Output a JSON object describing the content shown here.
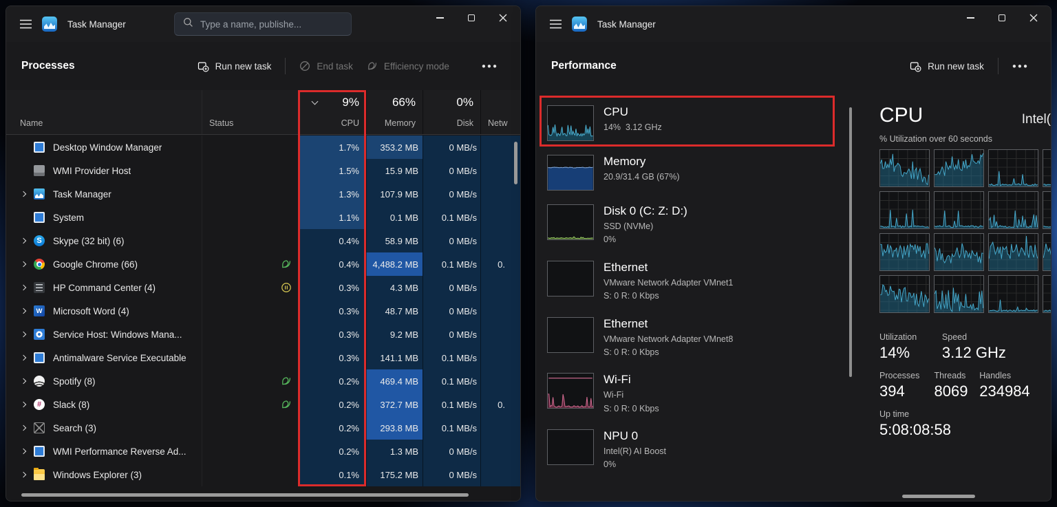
{
  "left_window": {
    "app_title": "Task Manager",
    "search": {
      "placeholder": "Type a name, publishe..."
    },
    "toolbar": {
      "heading": "Processes",
      "run_new_task": "Run new task",
      "end_task": "End task",
      "efficiency_mode": "Efficiency mode",
      "more": "●●●"
    },
    "table": {
      "headers": {
        "name": "Name",
        "status": "Status",
        "cpu": "CPU",
        "memory": "Memory",
        "disk": "Disk",
        "network": "Netw"
      },
      "totals": {
        "cpu": "9%",
        "memory": "66%",
        "disk": "0%"
      },
      "rows": [
        {
          "name": "Desktop Window Manager",
          "icon": "window",
          "expand": false,
          "status": "",
          "cpu": "1.7%",
          "cpu_heat": 2,
          "memory": "353.2 MB",
          "mem_heat": 2,
          "disk": "0 MB/s",
          "network": ""
        },
        {
          "name": "WMI Provider Host",
          "icon": "wmi",
          "expand": false,
          "status": "",
          "cpu": "1.5%",
          "cpu_heat": 2,
          "memory": "15.9 MB",
          "mem_heat": 0,
          "disk": "0 MB/s",
          "network": ""
        },
        {
          "name": "Task Manager",
          "icon": "taskmgr",
          "expand": true,
          "status": "",
          "cpu": "1.3%",
          "cpu_heat": 2,
          "memory": "107.9 MB",
          "mem_heat": 0,
          "disk": "0 MB/s",
          "network": ""
        },
        {
          "name": "System",
          "icon": "window",
          "expand": false,
          "status": "",
          "cpu": "1.1%",
          "cpu_heat": 2,
          "memory": "0.1 MB",
          "mem_heat": 0,
          "disk": "0.1 MB/s",
          "network": ""
        },
        {
          "name": "Skype (32 bit) (6)",
          "icon": "skype",
          "expand": true,
          "status": "",
          "cpu": "0.4%",
          "cpu_heat": 0,
          "memory": "58.9 MB",
          "mem_heat": 0,
          "disk": "0 MB/s",
          "network": ""
        },
        {
          "name": "Google Chrome (66)",
          "icon": "chrome",
          "expand": true,
          "status": "leaf",
          "cpu": "0.4%",
          "cpu_heat": 0,
          "memory": "4,488.2 MB",
          "mem_heat": 3,
          "disk": "0.1 MB/s",
          "network": "0."
        },
        {
          "name": "HP Command Center (4)",
          "icon": "hp",
          "expand": true,
          "status": "pause",
          "cpu": "0.3%",
          "cpu_heat": 0,
          "memory": "4.3 MB",
          "mem_heat": 0,
          "disk": "0 MB/s",
          "network": ""
        },
        {
          "name": "Microsoft Word (4)",
          "icon": "word",
          "expand": true,
          "status": "",
          "cpu": "0.3%",
          "cpu_heat": 0,
          "memory": "48.7 MB",
          "mem_heat": 0,
          "disk": "0 MB/s",
          "network": ""
        },
        {
          "name": "Service Host: Windows Mana...",
          "icon": "gear",
          "expand": true,
          "status": "",
          "cpu": "0.3%",
          "cpu_heat": 0,
          "memory": "9.2 MB",
          "mem_heat": 0,
          "disk": "0 MB/s",
          "network": ""
        },
        {
          "name": "Antimalware Service Executable",
          "icon": "window",
          "expand": true,
          "status": "",
          "cpu": "0.3%",
          "cpu_heat": 0,
          "memory": "141.1 MB",
          "mem_heat": 0,
          "disk": "0.1 MB/s",
          "network": ""
        },
        {
          "name": "Spotify (8)",
          "icon": "spotify",
          "expand": true,
          "status": "leaf",
          "cpu": "0.2%",
          "cpu_heat": 0,
          "memory": "469.4 MB",
          "mem_heat": 3,
          "disk": "0.1 MB/s",
          "network": ""
        },
        {
          "name": "Slack (8)",
          "icon": "slack",
          "expand": true,
          "status": "leaf",
          "cpu": "0.2%",
          "cpu_heat": 0,
          "memory": "372.7 MB",
          "mem_heat": 3,
          "disk": "0.1 MB/s",
          "network": "0."
        },
        {
          "name": "Search (3)",
          "icon": "search",
          "expand": true,
          "status": "",
          "cpu": "0.2%",
          "cpu_heat": 0,
          "memory": "293.8 MB",
          "mem_heat": 3,
          "disk": "0.1 MB/s",
          "network": ""
        },
        {
          "name": "WMI Performance Reverse Ad...",
          "icon": "window",
          "expand": true,
          "status": "",
          "cpu": "0.2%",
          "cpu_heat": 0,
          "memory": "1.3 MB",
          "mem_heat": 0,
          "disk": "0 MB/s",
          "network": ""
        },
        {
          "name": "Windows Explorer (3)",
          "icon": "folder",
          "expand": true,
          "status": "",
          "cpu": "0.1%",
          "cpu_heat": 0,
          "memory": "175.2 MB",
          "mem_heat": 0,
          "disk": "0 MB/s",
          "network": ""
        }
      ]
    }
  },
  "right_window": {
    "app_title": "Task Manager",
    "toolbar": {
      "heading": "Performance",
      "run_new_task": "Run new task",
      "more": "●●●"
    },
    "perf_items": [
      {
        "title": "CPU",
        "lines": [
          "14%  3.12 GHz"
        ],
        "spark": "cpu"
      },
      {
        "title": "Memory",
        "lines": [
          "20.9/31.4 GB (67%)"
        ],
        "spark": "memory"
      },
      {
        "title": "Disk 0 (C: Z: D:)",
        "lines": [
          "SSD (NVMe)",
          "0%"
        ],
        "spark": "disk"
      },
      {
        "title": "Ethernet",
        "lines": [
          "VMware Network Adapter VMnet1",
          "S: 0 R: 0 Kbps"
        ],
        "spark": "flat"
      },
      {
        "title": "Ethernet",
        "lines": [
          "VMware Network Adapter VMnet8",
          "S: 0 R: 0 Kbps"
        ],
        "spark": "flat"
      },
      {
        "title": "Wi-Fi",
        "lines": [
          "Wi-Fi",
          "S: 0 R: 0 Kbps"
        ],
        "spark": "wifi"
      },
      {
        "title": "NPU 0",
        "lines": [
          "Intel(R) AI Boost",
          "0%"
        ],
        "spark": "flat"
      }
    ],
    "detail": {
      "title": "CPU",
      "cpu_name_partial": "Intel(",
      "graph_label": "% Utilization over 60 seconds",
      "stats_row1": [
        {
          "label": "Utilization",
          "value": "14%"
        },
        {
          "label": "Speed",
          "value": "3.12 GHz"
        }
      ],
      "stats_row2": [
        {
          "label": "Processes",
          "value": "394"
        },
        {
          "label": "Threads",
          "value": "8069"
        },
        {
          "label": "Handles",
          "value": "234984"
        }
      ],
      "stats_row3": [
        {
          "label": "Up time",
          "value": "5:08:08:58"
        }
      ],
      "core_graph_profiles": [
        "busyfall",
        "rise",
        "lowspike",
        "low",
        "lowspike",
        "lowspike",
        "lowspike",
        "low",
        "busy",
        "busymid",
        "busy",
        "busy",
        "busyfall",
        "bursts",
        "low",
        "low"
      ]
    }
  },
  "colors": {
    "annotation_red": "#dc2b2b",
    "heat_base": "#0e2a46",
    "heat_medium": "#1b4472",
    "heat_high": "#2057a4",
    "spark_cyan": "#4db6d9",
    "spark_pink": "#d76d93",
    "spark_green": "#9ccc65",
    "memory_blue": "#89aede"
  }
}
